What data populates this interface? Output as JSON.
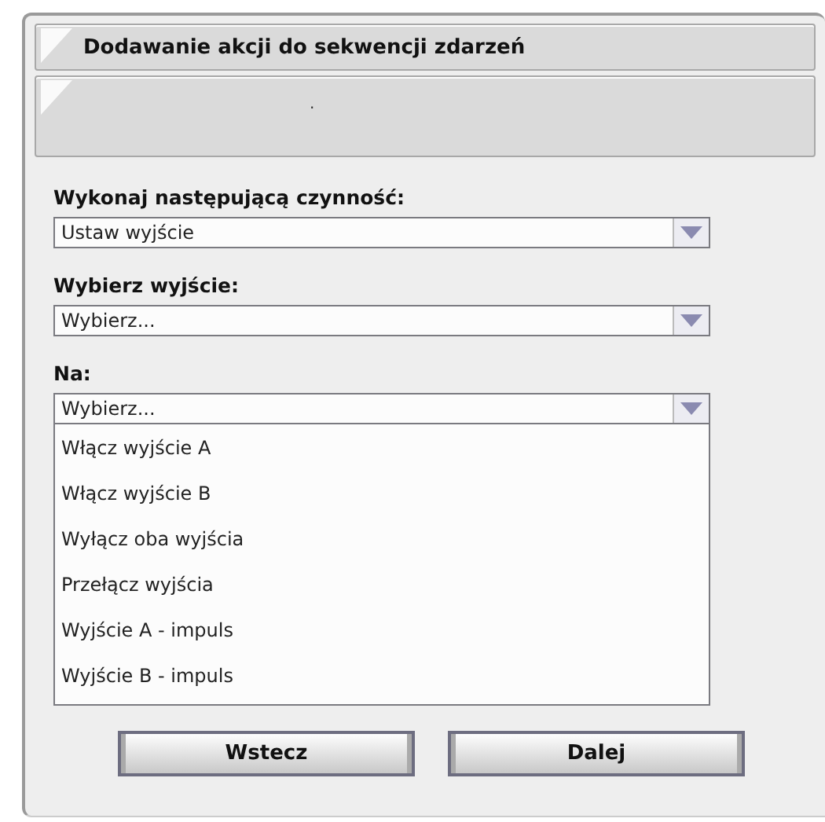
{
  "header": {
    "title": "Dodawanie akcji do sekwencji zdarzeń"
  },
  "info_panel": {
    "text": "."
  },
  "fields": [
    {
      "label": "Wykonaj następującą czynność:",
      "value": "Ustaw wyjście"
    },
    {
      "label": "Wybierz wyjście:",
      "value": "Wybierz..."
    },
    {
      "label": "Na:",
      "value": "Wybierz...",
      "options": [
        "Włącz wyjście A",
        "Włącz wyjście B",
        "Wyłącz oba wyjścia",
        "Przełącz wyjścia",
        "Wyjście A - impuls",
        "Wyjście B - impuls"
      ]
    }
  ],
  "buttons": [
    "Wstecz",
    "Dalej"
  ]
}
